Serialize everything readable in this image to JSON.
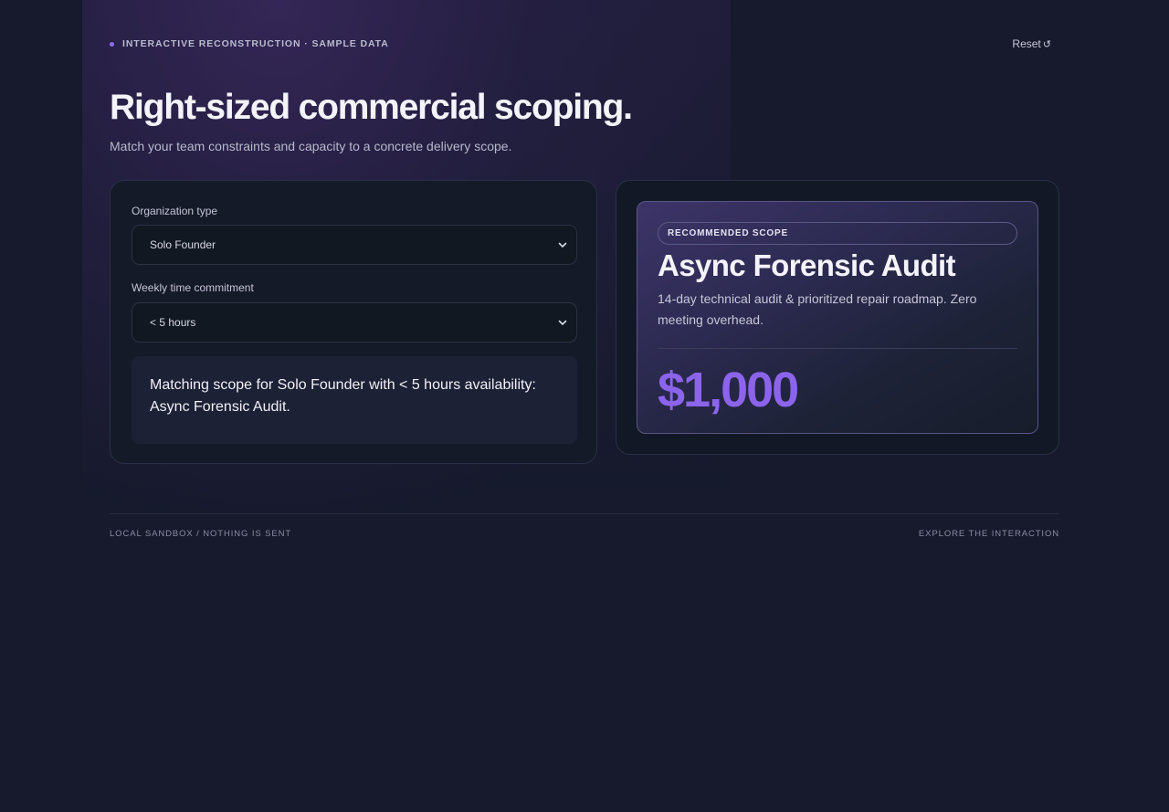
{
  "header": {
    "eyebrow": "INTERACTIVE RECONSTRUCTION · SAMPLE DATA",
    "reset_label": "Reset",
    "reset_icon": "↺"
  },
  "hero": {
    "title": "Right-sized commercial scoping.",
    "subtitle": "Match your team constraints and capacity to a concrete delivery scope."
  },
  "form": {
    "org_label": "Organization type",
    "org_value": "Solo Founder",
    "time_label": "Weekly time commitment",
    "time_value": "< 5 hours",
    "match_text": "Matching scope for Solo Founder with < 5 hours availability: Async Forensic Audit."
  },
  "result": {
    "badge": "RECOMMENDED SCOPE",
    "title": "Async Forensic Audit",
    "description": "14-day technical audit & prioritized repair roadmap. Zero meeting overhead.",
    "price": "$1,000"
  },
  "footer": {
    "left": "LOCAL SANDBOX / NOTHING IS SENT",
    "right": "EXPLORE THE INTERACTION"
  },
  "colors": {
    "accent": "#8c64ec",
    "background": "#161a2c"
  }
}
